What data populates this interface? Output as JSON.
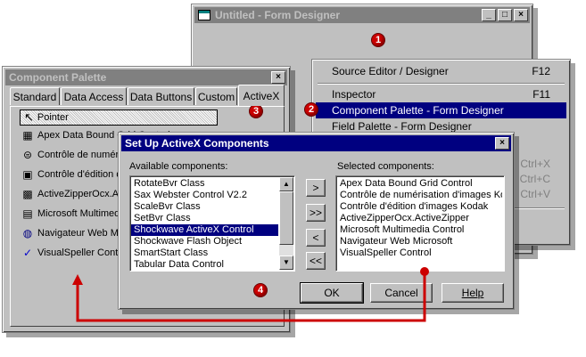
{
  "form_designer": {
    "title": "Untitled - Form Designer",
    "buttons": {
      "minimize": "_",
      "maximize": "□",
      "close": "×"
    }
  },
  "context_menu": {
    "items": [
      {
        "label": "Source Editor / Designer",
        "shortcut": "F12"
      },
      {
        "label": "Inspector",
        "shortcut": "F11"
      },
      {
        "label": "Component Palette - Form Designer",
        "shortcut": ""
      },
      {
        "label": "Field Palette - Form Designer",
        "shortcut": ""
      }
    ],
    "disabled_shortcuts": [
      "Ctrl+X",
      "Ctrl+C",
      "Ctrl+V"
    ]
  },
  "palette": {
    "title": "Component Palette",
    "close": "×",
    "tabs": [
      "Standard",
      "Data Access",
      "Data Buttons",
      "Custom",
      "ActiveX"
    ],
    "pointer_label": "Pointer",
    "items": [
      {
        "icon": "grid-icon",
        "glyph": "▦",
        "label": "Apex Data Bound Grid Control"
      },
      {
        "icon": "scanner-icon",
        "glyph": "⊜",
        "label": "Contrôle de numéri"
      },
      {
        "icon": "image-edit-icon",
        "glyph": "▣",
        "label": "Contrôle d'édition d"
      },
      {
        "icon": "zipper-icon",
        "glyph": "▩",
        "label": "ActiveZipperOcx.A"
      },
      {
        "icon": "multimedia-icon",
        "glyph": "▤",
        "label": "Microsoft Multimedi"
      },
      {
        "icon": "browser-icon",
        "glyph": "◍",
        "label": "Navigateur Web Mi"
      },
      {
        "icon": "speller-icon",
        "glyph": "✓",
        "label": "VisualSpeller Contro"
      }
    ]
  },
  "dialog": {
    "title": "Set Up ActiveX Components",
    "close": "×",
    "available_label": "Available components:",
    "selected_label": "Selected components:",
    "available": [
      "RotateBvr Class",
      "Sax Webster Control V2.2",
      "ScaleBvr Class",
      "SetBvr Class",
      "Shockwave ActiveX Control",
      "Shockwave Flash Object",
      "SmartStart Class",
      "Tabular Data Control"
    ],
    "available_selected_index": 4,
    "selected": [
      "Apex Data Bound Grid Control",
      "Contrôle de numérisation d'images Kod",
      "Contrôle d'édition d'images Kodak",
      "ActiveZipperOcx.ActiveZipper",
      "Microsoft Multimedia Control",
      "Navigateur Web Microsoft",
      "VisualSpeller Control"
    ],
    "move_buttons": [
      ">",
      ">>",
      "<",
      "<<"
    ],
    "ok": "OK",
    "cancel": "Cancel",
    "help": "Help"
  },
  "callouts": [
    "1",
    "2",
    "3",
    "4"
  ],
  "colors": {
    "accent": "#000080",
    "callout": "#cc0000"
  }
}
